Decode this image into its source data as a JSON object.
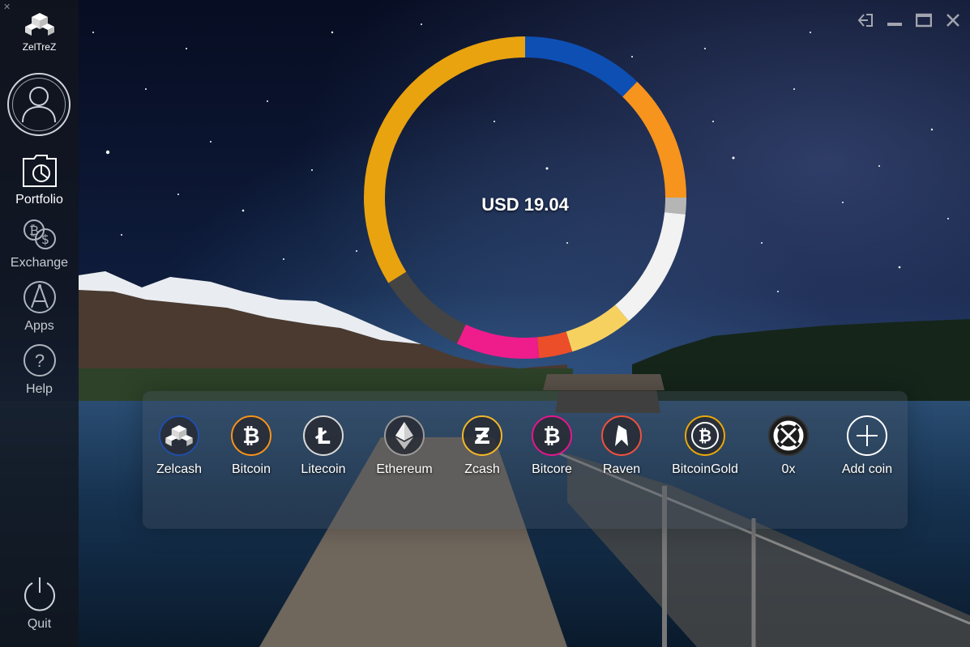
{
  "app": {
    "name": "ZelTreZ"
  },
  "sidebar": {
    "items": [
      {
        "label": "Portfolio",
        "icon": "portfolio-folder-icon"
      },
      {
        "label": "Exchange",
        "icon": "exchange-icon"
      },
      {
        "label": "Apps",
        "icon": "apps-compass-icon"
      },
      {
        "label": "Help",
        "icon": "help-icon"
      }
    ],
    "quit": {
      "label": "Quit",
      "icon": "power-icon"
    }
  },
  "portfolio": {
    "total": "USD 19.04",
    "segment_colors": [
      "#0e4fb3",
      "#f7941d",
      "#b5b5b5",
      "#f2f2f2",
      "#f7d160",
      "#ec4e2a",
      "#ef1c8c",
      "#444444",
      "#e8a30f"
    ]
  },
  "coins": [
    {
      "name": "Zelcash",
      "icon": "zelcash-icon",
      "color": "#1f4ea8"
    },
    {
      "name": "Bitcoin",
      "icon": "bitcoin-icon",
      "color": "#f7931a"
    },
    {
      "name": "Litecoin",
      "icon": "litecoin-icon",
      "color": "#d8d8d8"
    },
    {
      "name": "Ethereum",
      "icon": "ethereum-icon",
      "color": "#9a9a9a"
    },
    {
      "name": "Zcash",
      "icon": "zcash-icon",
      "color": "#f4b728"
    },
    {
      "name": "Bitcore",
      "icon": "bitcore-icon",
      "color": "#e4168d"
    },
    {
      "name": "Raven",
      "icon": "raven-icon",
      "color": "#f0513f"
    },
    {
      "name": "BitcoinGold",
      "icon": "bitcoingold-icon",
      "color": "#eba809"
    },
    {
      "name": "0x",
      "icon": "0x-icon",
      "color": "#333333"
    },
    {
      "name": "Add coin",
      "icon": "add-icon",
      "color": "#ffffff"
    }
  ]
}
